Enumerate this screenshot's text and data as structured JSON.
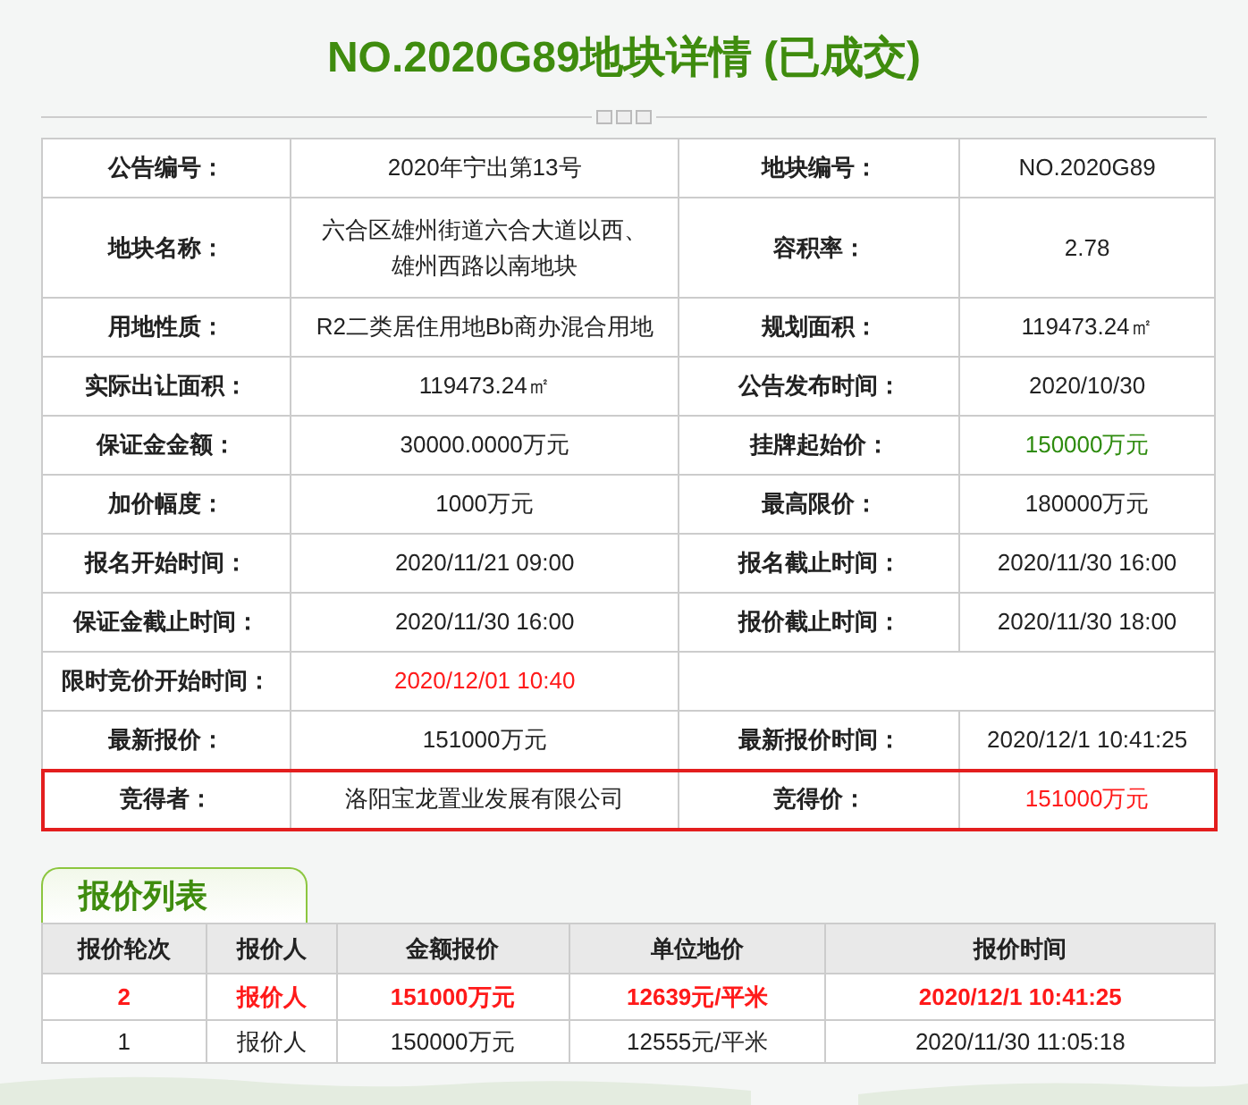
{
  "title": "NO.2020G89地块详情 (已成交)",
  "details": [
    {
      "highlighted": false,
      "fields": [
        {
          "label": "公告编号：",
          "value": "2020年宁出第13号"
        },
        {
          "label": "地块编号：",
          "value": "NO.2020G89"
        }
      ]
    },
    {
      "highlighted": false,
      "fields": [
        {
          "label": "地块名称：",
          "value": "六合区雄州街道六合大道以西、雄州西路以南地块"
        },
        {
          "label": "容积率：",
          "value": "2.78"
        }
      ]
    },
    {
      "highlighted": false,
      "fields": [
        {
          "label": "用地性质：",
          "value": "R2二类居住用地Bb商办混合用地"
        },
        {
          "label": "规划面积：",
          "value": "119473.24㎡"
        }
      ]
    },
    {
      "highlighted": false,
      "fields": [
        {
          "label": "实际出让面积：",
          "value": "119473.24㎡"
        },
        {
          "label": "公告发布时间：",
          "value": "2020/10/30"
        }
      ]
    },
    {
      "highlighted": false,
      "fields": [
        {
          "label": "保证金金额：",
          "value": "30000.0000万元"
        },
        {
          "label": "挂牌起始价：",
          "value": "150000万元",
          "color": "#2e8b0e"
        }
      ]
    },
    {
      "highlighted": false,
      "fields": [
        {
          "label": "加价幅度：",
          "value": "1000万元"
        },
        {
          "label": "最高限价：",
          "value": "180000万元"
        }
      ]
    },
    {
      "highlighted": false,
      "fields": [
        {
          "label": "报名开始时间：",
          "value": "2020/11/21 09:00"
        },
        {
          "label": "报名截止时间：",
          "value": "2020/11/30 16:00"
        }
      ]
    },
    {
      "highlighted": false,
      "fields": [
        {
          "label": "保证金截止时间：",
          "value": "2020/11/30 16:00"
        },
        {
          "label": "报价截止时间：",
          "value": "2020/11/30 18:00"
        }
      ]
    },
    {
      "highlighted": false,
      "fields": [
        {
          "label": "限时竞价开始时间：",
          "value": "2020/12/01 10:40",
          "color": "#ff1a1a"
        }
      ]
    },
    {
      "highlighted": false,
      "fields": [
        {
          "label": "最新报价：",
          "value": "151000万元"
        },
        {
          "label": "最新报价时间：",
          "value": "2020/12/1 10:41:25"
        }
      ]
    },
    {
      "highlighted": true,
      "fields": [
        {
          "label": "竞得者：",
          "value": "洛阳宝龙置业发展有限公司"
        },
        {
          "label": "竞得价：",
          "value": "151000万元",
          "color": "#ff1a1a"
        }
      ]
    }
  ],
  "bids": {
    "tab": "报价列表",
    "columns": [
      "报价轮次",
      "报价人",
      "金额报价",
      "单位地价",
      "报价时间"
    ],
    "rows": [
      {
        "latest": true,
        "cells": [
          "2",
          "报价人",
          "151000万元",
          "12639元/平米",
          "2020/12/1 10:41:25"
        ]
      },
      {
        "latest": false,
        "cells": [
          "1",
          "报价人",
          "150000万元",
          "12555元/平米",
          "2020/11/30 11:05:18"
        ]
      }
    ]
  }
}
